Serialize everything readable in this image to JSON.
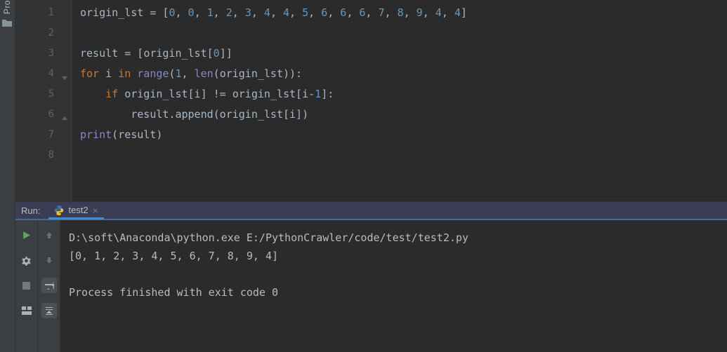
{
  "sidebar": {
    "tab_label": "Pro"
  },
  "editor": {
    "line_numbers": [
      "1",
      "2",
      "3",
      "4",
      "5",
      "6",
      "7",
      "8"
    ],
    "code": {
      "l1": {
        "pre": "origin_lst ",
        "op": "= ",
        "br1": "[",
        "nums_joined": "0, 0, 1, 2, 3, 4, 4, 5, 6, 6, 6, 7, 8, 9, 4, 4",
        "br2": "]"
      },
      "l3": {
        "pre": "result ",
        "op": "= ",
        "br1": "[",
        "ref": "origin_lst[",
        "idx": "0",
        "br2": "]]"
      },
      "l4": {
        "kw1": "for ",
        "var": "i ",
        "kw2": "in ",
        "fn": "range",
        "open": "(",
        "a": "1",
        ", ": " ",
        "len": "len",
        "open2": "(",
        "arg": "origin_lst",
        "close": ")):"
      },
      "l5": {
        "indent": "    ",
        "kw": "if ",
        "lhs": "origin_lst[i] ",
        "op": "!= ",
        "rhs": "origin_lst[i-",
        "one": "1",
        "end": "]:"
      },
      "l6": {
        "indent": "        ",
        "call": "result.append(origin_lst[i])"
      },
      "l7": {
        "fn": "print",
        "rest": "(result)"
      }
    }
  },
  "run": {
    "label": "Run:",
    "tab_name": "test2",
    "output_line1": "D:\\soft\\Anaconda\\python.exe E:/PythonCrawler/code/test/test2.py",
    "output_line2": "[0, 1, 2, 3, 4, 5, 6, 7, 8, 9, 4]",
    "output_line3": "",
    "output_line4": "Process finished with exit code 0"
  },
  "chart_data": {
    "type": "table",
    "title": "Script input and output",
    "origin_lst": [
      0,
      0,
      1,
      2,
      3,
      4,
      4,
      5,
      6,
      6,
      6,
      7,
      8,
      9,
      4,
      4
    ],
    "result": [
      0,
      1,
      2,
      3,
      4,
      5,
      6,
      7,
      8,
      9,
      4
    ],
    "exit_code": 0
  }
}
